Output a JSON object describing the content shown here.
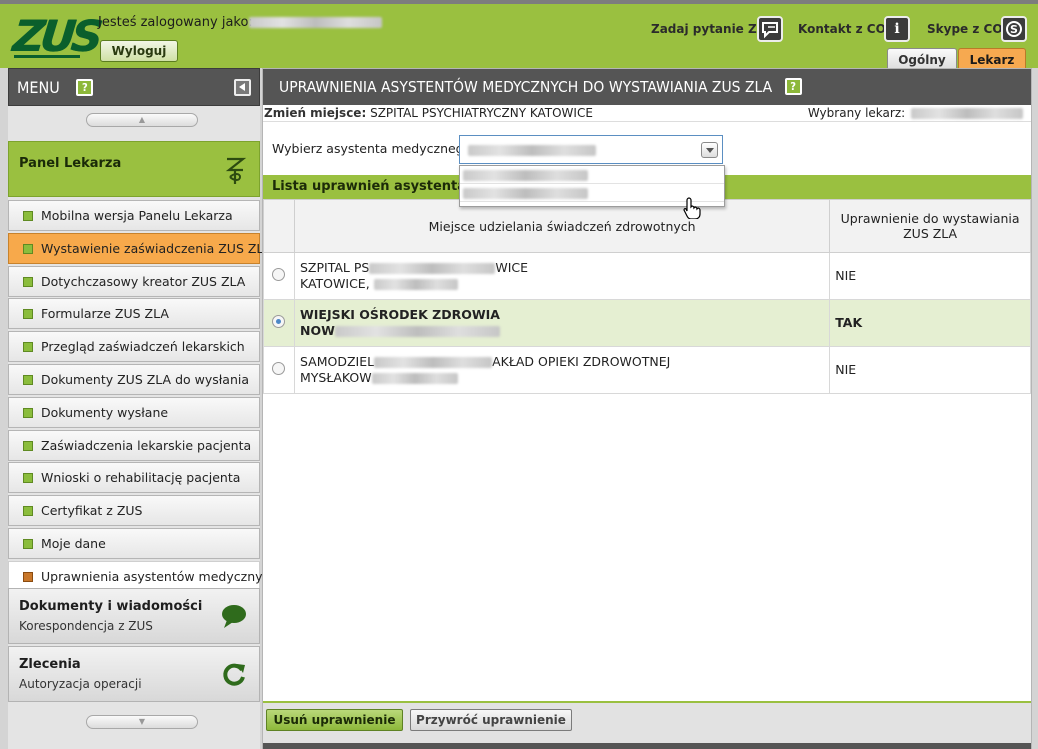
{
  "header": {
    "logo_text": "ZUS",
    "logged_label": "Jesteś zalogowany jako:",
    "logout_label": "Wyloguj",
    "links": [
      {
        "label": "Zadaj pytanie ZUS",
        "icon": "chat-bubble-icon"
      },
      {
        "label": "Kontakt z COT",
        "icon": "info-icon"
      },
      {
        "label": "Skype z COT",
        "icon": "skype-icon"
      }
    ],
    "tabs": [
      {
        "label": "Ogólny",
        "active": false
      },
      {
        "label": "Lekarz",
        "active": true
      }
    ]
  },
  "sidebar": {
    "menu_title": "MENU",
    "help_symbol": "?",
    "panel_title": "Panel Lekarza",
    "items": [
      {
        "label": "Mobilna wersja Panelu Lekarza"
      },
      {
        "label": "Wystawienie zaświadczenia ZUS ZLA",
        "state": "highlighted"
      },
      {
        "label": "Dotychczasowy kreator ZUS ZLA"
      },
      {
        "label": "Formularze ZUS ZLA"
      },
      {
        "label": "Przegląd zaświadczeń lekarskich"
      },
      {
        "label": "Dokumenty ZUS ZLA do wysłania"
      },
      {
        "label": "Dokumenty wysłane"
      },
      {
        "label": "Zaświadczenia lekarskie pacjenta"
      },
      {
        "label": "Wnioski o rehabilitację pacjenta"
      },
      {
        "label": "Certyfikat z ZUS"
      },
      {
        "label": "Moje dane"
      },
      {
        "label": "Uprawnienia asystentów medycznych",
        "state": "current"
      }
    ],
    "groups": [
      {
        "title": "Dokumenty i wiadomości",
        "subtitle": "Korespondencja z ZUS"
      },
      {
        "title": "Zlecenia",
        "subtitle": "Autoryzacja operacji"
      }
    ]
  },
  "main": {
    "title": "Uprawnienia asystentów medycznych do wystawiania ZUS ZLA",
    "change_place_label": "Zmień miejsce:",
    "place_value": "SZPITAL PSYCHIATRYCZNY KATOWICE",
    "chosen_doctor_label": "Wybrany lekarz:",
    "choose_assistant_label": "Wybierz asystenta medycznego",
    "list_title": "Lista uprawnień asystenta m",
    "table": {
      "columns": [
        "Miejsce udzielania świadczeń zdrowotnych",
        "Uprawnienie do wystawiania ZUS ZLA"
      ],
      "rows": [
        {
          "line1": "SZPITAL PS",
          "line1_end": "WICE",
          "line2": "KATOWICE,",
          "permission": "NIE",
          "selected": false
        },
        {
          "line1": "WIEJSKI OŚRODEK ZDROWIA",
          "line1_end": "",
          "line2": "NOW",
          "permission": "TAK",
          "selected": true
        },
        {
          "line1": "SAMODZIEL",
          "line1_end": "AKŁAD OPIEKI ZDROWOTNEJ",
          "line2": "MYSŁAKOW",
          "permission": "NIE",
          "selected": false
        }
      ]
    },
    "buttons": {
      "remove": "Usuń uprawnienie",
      "restore": "Przywróć uprawnienie"
    }
  },
  "colors": {
    "brand_green": "#9ac040",
    "logo_green": "#0a5f2c",
    "dark_header": "#555555",
    "active_orange": "#f7a94b",
    "selected_row": "#e5efd2"
  }
}
